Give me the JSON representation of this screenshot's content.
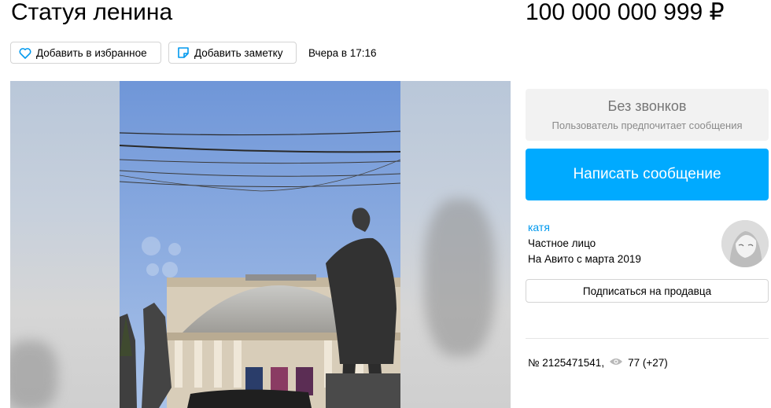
{
  "listing": {
    "title": "Статуя ленина",
    "price": "100 000 000 999 ₽",
    "posted": "Вчера в 17:16"
  },
  "actions": {
    "favorite_label": "Добавить в избранное",
    "note_label": "Добавить заметку"
  },
  "contact": {
    "no_calls_title": "Без звонков",
    "no_calls_sub": "Пользователь предпочитает сообщения",
    "message_button": "Написать сообщение"
  },
  "seller": {
    "name": "катя",
    "type": "Частное лицо",
    "since": "На Авито с марта 2019",
    "subscribe_label": "Подписаться на продавца"
  },
  "stats": {
    "number": "№ 2125471541,",
    "views": "77 (+27)"
  },
  "colors": {
    "accent": "#00aaff",
    "link": "#0099ee",
    "muted": "#767676"
  },
  "icons": [
    "heart-icon",
    "note-icon",
    "eye-icon"
  ]
}
